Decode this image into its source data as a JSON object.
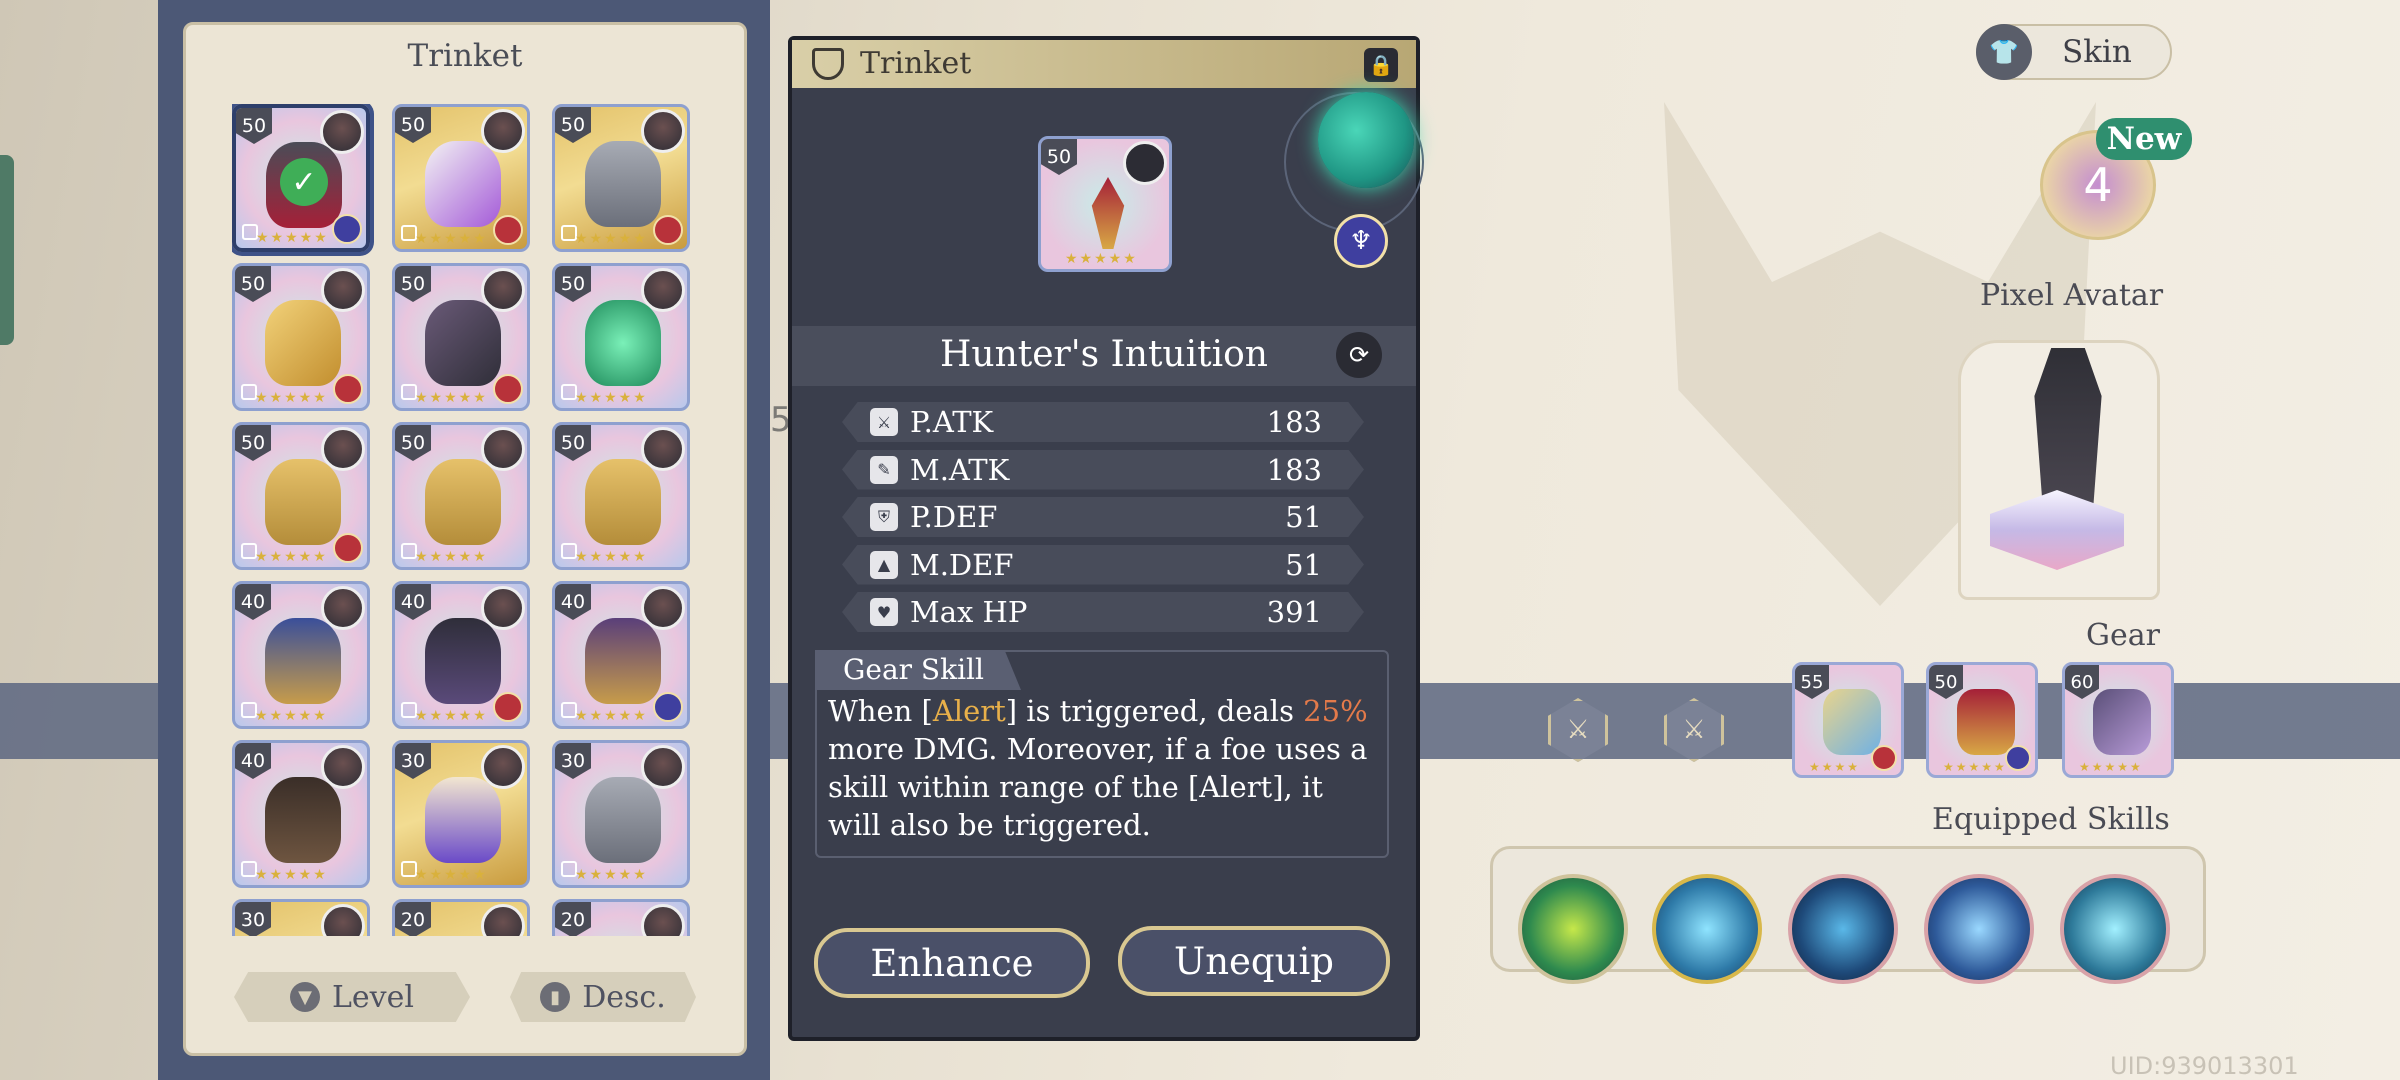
{
  "left_panel": {
    "title": "Trinket",
    "items": [
      {
        "level": "50",
        "style": "pink",
        "selected": true,
        "class_color": "blue",
        "icon": "candelabra-icon"
      },
      {
        "level": "50",
        "style": "gold",
        "selected": false,
        "class_color": "red",
        "icon": "potion-bottle-icon"
      },
      {
        "level": "50",
        "style": "gold",
        "selected": false,
        "class_color": "red",
        "icon": "armor-icon"
      },
      {
        "level": "50",
        "style": "pink",
        "selected": false,
        "class_color": "red",
        "icon": "golden-cross-icon"
      },
      {
        "level": "50",
        "style": "pink",
        "selected": false,
        "class_color": "red",
        "icon": "spider-charm-icon"
      },
      {
        "level": "50",
        "style": "pink",
        "selected": false,
        "class_color": "none",
        "icon": "green-orb-icon"
      },
      {
        "level": "50",
        "style": "pink",
        "selected": false,
        "class_color": "red",
        "icon": "clam-pearl-icon"
      },
      {
        "level": "50",
        "style": "pink",
        "selected": false,
        "class_color": "none",
        "icon": "clam-pearl-icon"
      },
      {
        "level": "50",
        "style": "pink",
        "selected": false,
        "class_color": "none",
        "icon": "clam-pearl-icon"
      },
      {
        "level": "40",
        "style": "pink",
        "selected": false,
        "class_color": "none",
        "icon": "hourglass-icon"
      },
      {
        "level": "40",
        "style": "pink",
        "selected": false,
        "class_color": "red",
        "icon": "hooded-cloak-icon"
      },
      {
        "level": "40",
        "style": "pink",
        "selected": false,
        "class_color": "blue",
        "icon": "witch-hat-icon"
      },
      {
        "level": "40",
        "style": "pink",
        "selected": false,
        "class_color": "none",
        "icon": "cloak-icon"
      },
      {
        "level": "30",
        "style": "gold",
        "selected": false,
        "class_color": "none",
        "icon": "mask-icon"
      },
      {
        "level": "30",
        "style": "pink",
        "selected": false,
        "class_color": "none",
        "icon": "armor-icon"
      },
      {
        "level": "30",
        "style": "gold",
        "selected": false,
        "class_color": "none",
        "icon": "item-icon"
      },
      {
        "level": "20",
        "style": "gold",
        "selected": false,
        "class_color": "none",
        "icon": "item-icon"
      },
      {
        "level": "20",
        "style": "pink",
        "selected": false,
        "class_color": "none",
        "icon": "item-icon"
      }
    ],
    "sort_level": "Level",
    "sort_order": "Desc."
  },
  "detail": {
    "header": "Trinket",
    "level": "50",
    "name": "Hunter's Intuition",
    "stats": [
      {
        "name": "P.ATK",
        "value": "183",
        "icon": "sword-icon"
      },
      {
        "name": "M.ATK",
        "value": "183",
        "icon": "wand-icon"
      },
      {
        "name": "P.DEF",
        "value": "51",
        "icon": "shield-icon"
      },
      {
        "name": "M.DEF",
        "value": "51",
        "icon": "hat-icon"
      },
      {
        "name": "Max HP",
        "value": "391",
        "icon": "heart-icon"
      }
    ],
    "skill_label": "Gear Skill",
    "skill_text": {
      "p1": "When [",
      "alert": "Alert",
      "p2": "] is triggered, deals ",
      "pct": "25%",
      "p3": " more DMG. Moreover, if a foe uses a skill within range of the [Alert], it will also be triggered."
    },
    "enhance": "Enhance",
    "unequip": "Unequip"
  },
  "right": {
    "skin": "Skin",
    "new_badge": "New",
    "heart_count": "4",
    "pixel_avatar": "Pixel Avatar",
    "gear_label": "Gear",
    "gear_levels": [
      "55",
      "50",
      "60"
    ],
    "equipped_skills": "Equipped Skills",
    "uid": "UID:939013301"
  },
  "background_glyphs": {
    "g1": "5"
  },
  "colors": {
    "accent_gold": "#d9c891",
    "panel_dark": "#3a3e4c",
    "highlight": "#e8b04a",
    "percent": "#e47a4a"
  }
}
